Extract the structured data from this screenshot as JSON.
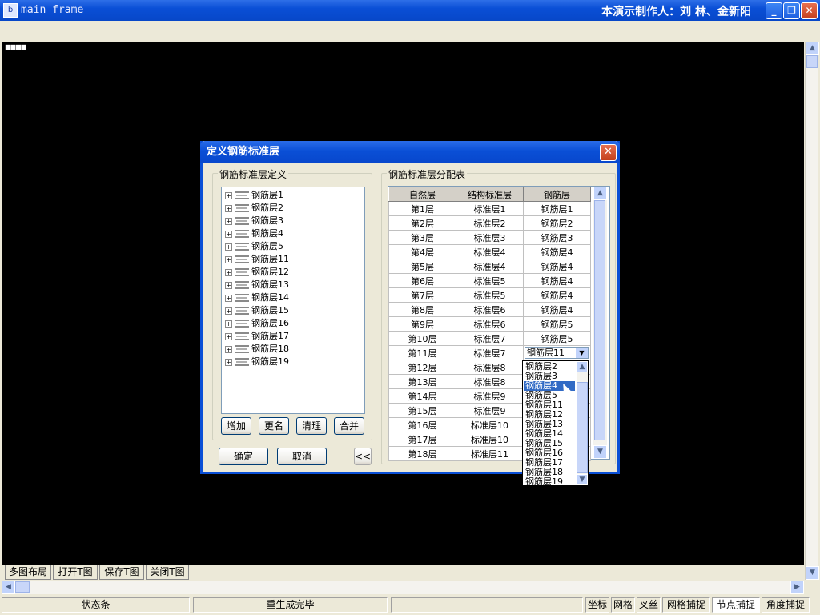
{
  "app": {
    "title": "main frame",
    "credit": "本演示制作人：刘  林、金新阳",
    "icon_label": "b",
    "canvas_marks": "■■■■"
  },
  "icons": [
    "app-icon",
    "minimize-icon",
    "restore-icon",
    "close-icon",
    "plus-expand-icon",
    "layers-icon",
    "scroll-up-icon",
    "scroll-down-icon",
    "scroll-left-icon",
    "scroll-right-icon",
    "dropdown-arrow-icon",
    "cursor-icon"
  ],
  "window_buttons": {
    "minimize": "_",
    "restore": "❐",
    "close": "✕"
  },
  "tabs": [
    "多图布局",
    "打开T图",
    "保存T图",
    "关闭T图"
  ],
  "status": {
    "state": "状态条",
    "message": "重生成完毕",
    "toggles": [
      "坐标",
      "网格",
      "叉丝",
      "网格捕捉",
      "节点捕捉",
      "角度捕捉"
    ]
  },
  "dialog": {
    "title": "定义钢筋标准层",
    "left_group_label": "钢筋标准层定义",
    "tree_items": [
      "钢筋层1",
      "钢筋层2",
      "钢筋层3",
      "钢筋层4",
      "钢筋层5",
      "钢筋层11",
      "钢筋层12",
      "钢筋层13",
      "钢筋层14",
      "钢筋层15",
      "钢筋层16",
      "钢筋层17",
      "钢筋层18",
      "钢筋层19"
    ],
    "buttons": {
      "add": "增加",
      "rename": "更名",
      "clear": "清理",
      "merge": "合并",
      "ok": "确定",
      "cancel": "取消",
      "collapse": "<<"
    },
    "right_group_label": "钢筋标准层分配表",
    "columns": [
      "自然层",
      "结构标准层",
      "钢筋层"
    ],
    "rows": [
      [
        "第1层",
        "标准层1",
        "钢筋层1"
      ],
      [
        "第2层",
        "标准层2",
        "钢筋层2"
      ],
      [
        "第3层",
        "标准层3",
        "钢筋层3"
      ],
      [
        "第4层",
        "标准层4",
        "钢筋层4"
      ],
      [
        "第5层",
        "标准层4",
        "钢筋层4"
      ],
      [
        "第6层",
        "标准层5",
        "钢筋层4"
      ],
      [
        "第7层",
        "标准层5",
        "钢筋层4"
      ],
      [
        "第8层",
        "标准层6",
        "钢筋层4"
      ],
      [
        "第9层",
        "标准层6",
        "钢筋层5"
      ],
      [
        "第10层",
        "标准层7",
        "钢筋层5"
      ],
      [
        "第11层",
        "标准层7",
        "钢筋层11"
      ],
      [
        "第12层",
        "标准层8",
        ""
      ],
      [
        "第13层",
        "标准层8",
        ""
      ],
      [
        "第14层",
        "标准层9",
        ""
      ],
      [
        "第15层",
        "标准层9",
        ""
      ],
      [
        "第16层",
        "标准层10",
        ""
      ],
      [
        "第17层",
        "标准层10",
        ""
      ],
      [
        "第18层",
        "标准层11",
        ""
      ]
    ],
    "editing_row": 10,
    "combo_value": "钢筋层11",
    "dropdown_items": [
      "钢筋层2",
      "钢筋层3",
      "钢筋层4",
      "钢筋层5",
      "钢筋层11",
      "钢筋层12",
      "钢筋层13",
      "钢筋层14",
      "钢筋层15",
      "钢筋层16",
      "钢筋层17",
      "钢筋层18",
      "钢筋层19"
    ],
    "dropdown_selected": "钢筋层4"
  },
  "colors": {
    "titlebar": "#0a4fd6",
    "selection": "#316ac5",
    "canvas": "#000000",
    "close": "#c4401c"
  }
}
